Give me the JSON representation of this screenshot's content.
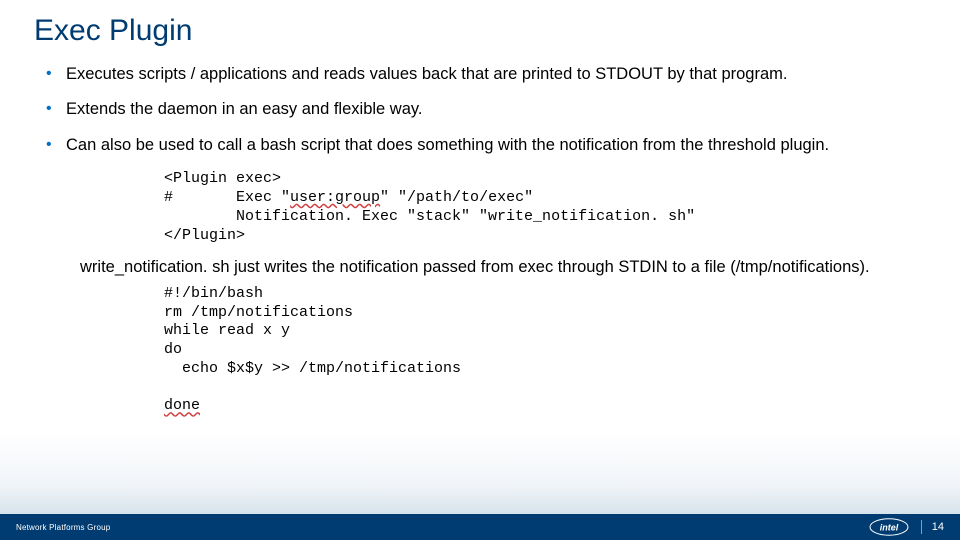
{
  "title": "Exec Plugin",
  "bullets": [
    "Executes scripts / applications and reads values back that are printed to STDOUT by that program.",
    "Extends the daemon in an easy and flexible way.",
    "Can also be used to call a bash script that does something with the notification from the threshold plugin."
  ],
  "code1": {
    "l1": "<Plugin exec>",
    "l2a": "#       Exec \"",
    "l2b": "user:group",
    "l2c": "\" \"/path/to/exec\"",
    "l3": "        Notification. Exec \"stack\" \"write_notification. sh\"",
    "l4": "</Plugin>"
  },
  "desc": "write_notification. sh just writes the notification passed from exec through STDIN to a file (/tmp/notifications).",
  "code2": {
    "l1": "#!/bin/bash",
    "l2": "rm /tmp/notifications",
    "l3": "while read x y",
    "l4": "do",
    "l5": "  echo $x$y >> /tmp/notifications",
    "l6": "",
    "l7": "done"
  },
  "footer": {
    "group": "Network Platforms Group",
    "page": "14",
    "logo_label": "intel"
  }
}
